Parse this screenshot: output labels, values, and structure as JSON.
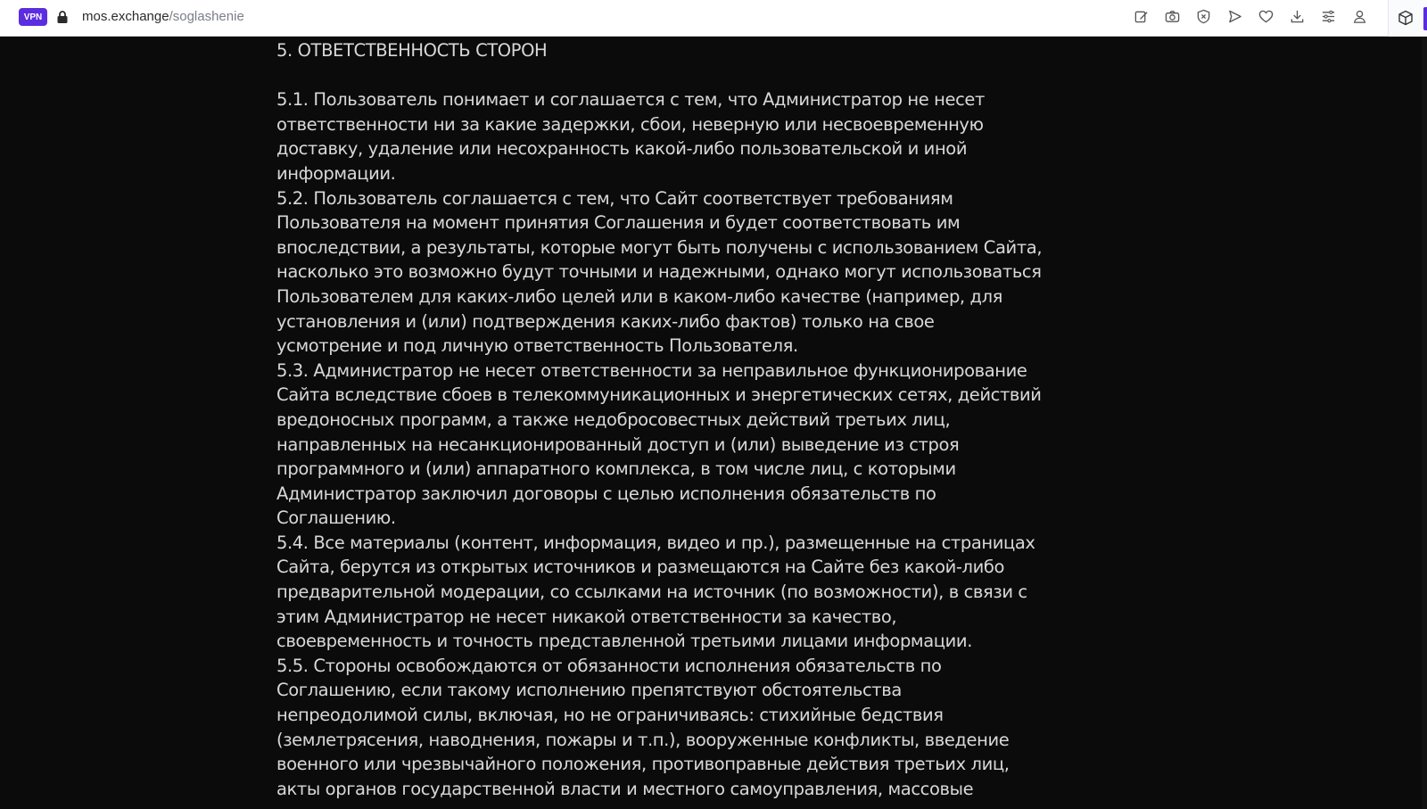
{
  "browser": {
    "vpn_label": "VPN",
    "url_host": "mos.exchange",
    "url_path": "/soglashenie",
    "toolbar_icons": [
      "edit-icon",
      "camera-icon",
      "shield-x-icon",
      "send-icon",
      "heart-icon",
      "download-icon",
      "menu-icon",
      "profile-icon"
    ],
    "extension_icon": "cube-icon",
    "accent_color": "#5b2de0"
  },
  "document": {
    "heading": "5. ОТВЕТСТВЕННОСТЬ СТОРОН",
    "paragraphs": [
      "5.1. Пользователь понимает и соглашается с тем, что Администратор не несет ответственности ни за какие задержки, сбои, неверную или несвоевременную доставку, удаление или несохранность какой-либо пользовательской и иной информации.",
      "5.2. Пользователь соглашается с тем, что Сайт соответствует требованиям Пользователя на момент принятия Соглашения и будет соответствовать им впоследствии, а результаты, которые могут быть получены с использованием Сайта, насколько это возможно будут точными и надежными, однако могут использоваться Пользователем для каких-либо целей или в каком-либо качестве (например, для установления и (или) подтверждения каких-либо фактов) только на свое усмотрение и под личную ответственность Пользователя.",
      "5.3. Администратор не несет ответственности за неправильное функционирование Сайта вследствие сбоев в телекоммуникационных и энергетических сетях, действий вредоносных программ, а также недобросовестных действий третьих лиц, направленных на несанкционированный доступ и (или) выведение из строя программного и (или) аппаратного комплекса, в том числе лиц, с которыми Администратор заключил договоры с целью исполнения обязательств по Соглашению.",
      "5.4. Все материалы (контент, информация, видео и пр.), размещенные на страницах Сайта, берутся из открытых источников и размещаются на Сайте без какой-либо предварительной модерации, со ссылками на источник (по возможности), в связи с этим Администратор не несет никакой ответственности за качество, своевременность и точность представленной третьими лицами информации.",
      "5.5. Стороны освобождаются от обязанности исполнения обязательств по Соглашению, если такому исполнению препятствуют обстоятельства непреодолимой силы, включая, но не ограничиваясь: стихийные бедствия (землетрясения, наводнения, пожары и т.п.), вооруженные конфликты, введение военного или чрезвычайного положения, противоправные действия третьих лиц, акты органов государственной власти и местного самоуправления, массовые"
    ]
  }
}
